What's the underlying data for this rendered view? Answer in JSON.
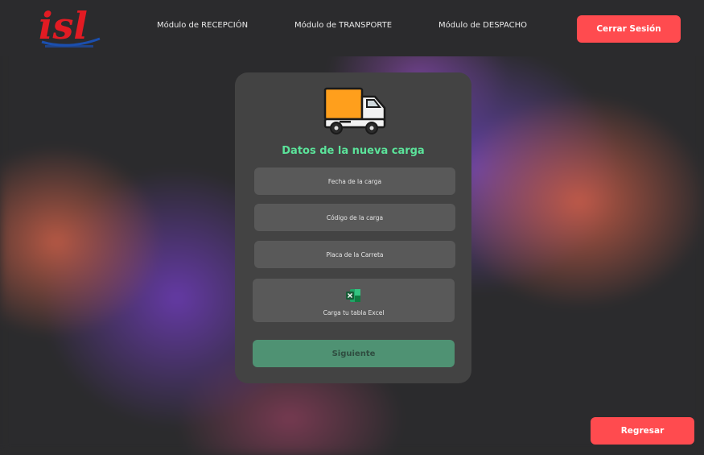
{
  "header": {
    "logo_text": "isl",
    "nav": [
      {
        "label": "Módulo de RECEPCIÓN"
      },
      {
        "label": "Módulo de TRANSPORTE"
      },
      {
        "label": "Módulo de DESPACHO"
      }
    ],
    "logout_label": "Cerrar Sesión"
  },
  "form": {
    "title": "Datos de la nueva carga",
    "fields": [
      {
        "placeholder": "Fecha de la carga"
      },
      {
        "placeholder": "Código de la carga"
      },
      {
        "placeholder": "Placa de la Carreta"
      }
    ],
    "upload": {
      "label": "Carga tu tabla Excel",
      "icon": "excel-icon"
    },
    "next_label": "Siguiente",
    "icon": "truck-icon"
  },
  "footer": {
    "back_label": "Regresar"
  },
  "colors": {
    "accent_red": "#ff4b4f",
    "title_green": "#5be39a",
    "button_green": "#4f9273",
    "card_bg": "#434343",
    "field_bg": "#595959",
    "page_bg": "#2b2b2d"
  }
}
